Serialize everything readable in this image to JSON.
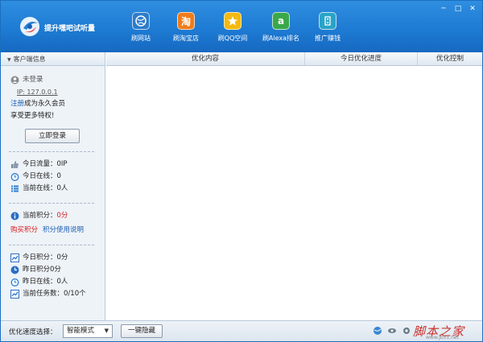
{
  "app": {
    "title": "提升嘿吧试听量"
  },
  "nav": [
    {
      "label": "刷网站",
      "icon": "globe-icon"
    },
    {
      "label": "刷淘宝店",
      "icon": "taobao-icon",
      "glyph": "淘"
    },
    {
      "label": "刷QQ空间",
      "icon": "qzone-star-icon"
    },
    {
      "label": "刷Alexa排名",
      "icon": "alexa-icon",
      "glyph": "a"
    },
    {
      "label": "推广赚钱",
      "icon": "promote-icon"
    }
  ],
  "window": {
    "min": "─",
    "max": "□",
    "close": "✕"
  },
  "sidebar": {
    "header": "客户端信息",
    "login_status": "未登录",
    "ip": "IP: 127.0.0.1",
    "register_link": "注册",
    "register_text": "成为永久会员",
    "privilege_text": "享受更多特权!",
    "login_button": "立即登录",
    "stats1": [
      {
        "label": "今日流量：",
        "value": "0IP",
        "icon": "thumb-up-icon"
      },
      {
        "label": "今日在线：",
        "value": "0",
        "icon": "alarm-clock-icon"
      },
      {
        "label": "当前在线：",
        "value": "0人",
        "icon": "list-icon"
      }
    ],
    "points_label": "当前积分：",
    "points_value": "0分",
    "buy_points": "购买积分",
    "points_help": "积分使用说明",
    "stats2": [
      {
        "label": "今日积分：",
        "value": "0分",
        "icon": "chart-icon"
      },
      {
        "label": "昨日积分",
        "value": "0分",
        "icon": "clock-icon"
      },
      {
        "label": "昨日在线：",
        "value": "0人",
        "icon": "alarm-clock-icon"
      },
      {
        "label": "当前任务数：",
        "value": "0/10个",
        "icon": "chart-icon"
      }
    ]
  },
  "table": {
    "columns": [
      "优化内容",
      "今日优化进度",
      "优化控制"
    ]
  },
  "footer": {
    "speed_label": "优化速度选择：",
    "speed_value": "智能模式",
    "hide_button": "一键隐藏",
    "watermark": "脚本之家",
    "watermark_sub": "www.jb51.net"
  },
  "colors": {
    "header": "#1e7bd3",
    "taobao": "#f07c1a",
    "qzone": "#f5b90f",
    "alexa": "#3aa84a",
    "promote": "#2aa3c7",
    "red": "#d61a1a"
  }
}
